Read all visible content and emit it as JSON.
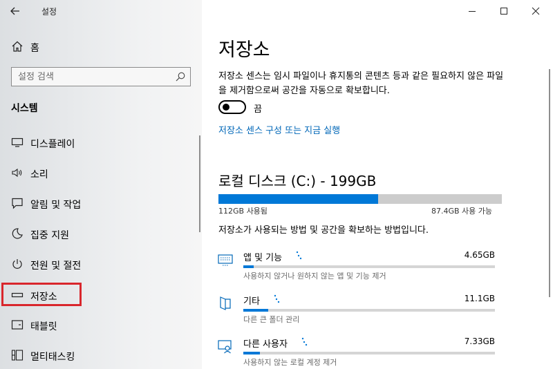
{
  "window": {
    "title": "설정"
  },
  "sidebar": {
    "home_label": "홈",
    "search_placeholder": "설정 검색",
    "section_title": "시스템",
    "items": [
      {
        "label": "디스플레이",
        "icon": "monitor-icon"
      },
      {
        "label": "소리",
        "icon": "speaker-icon"
      },
      {
        "label": "알림 및 작업",
        "icon": "notification-icon"
      },
      {
        "label": "집중 지원",
        "icon": "moon-icon"
      },
      {
        "label": "전원 및 절전",
        "icon": "power-icon"
      },
      {
        "label": "저장소",
        "icon": "storage-icon",
        "selected": true
      },
      {
        "label": "태블릿",
        "icon": "tablet-icon"
      },
      {
        "label": "멀티태스킹",
        "icon": "multitask-icon"
      }
    ]
  },
  "main": {
    "title": "저장소",
    "description": "저장소 센스는 임시 파일이나 휴지통의 콘텐츠 등과 같은 필요하지 않은 파일을 제거함으로써 공간을 자동으로 확보합니다.",
    "toggle": {
      "state": "off",
      "label": "끔"
    },
    "link": "저장소 센스 구성 또는 지금 실행",
    "disk": {
      "title": "로컬 디스크 (C:) - 199GB",
      "used_label": "112GB 사용됨",
      "free_label": "87.4GB 사용 가능",
      "used_fraction": 0.5628
    },
    "info": "저장소가 사용되는 방법 및 공간을 확보하는 방법입니다.",
    "categories": [
      {
        "name": "앱 및 기능",
        "size": "4.65GB",
        "desc": "사용하지 않거나 원하지 않는 앱 및 기능 제거",
        "fraction": 0.04,
        "icon": "apps-icon"
      },
      {
        "name": "기타",
        "size": "11.1GB",
        "desc": "다른 큰 폴더 관리",
        "fraction": 0.099,
        "icon": "folder-icon"
      },
      {
        "name": "다른 사용자",
        "size": "7.33GB",
        "desc": "사용하지 않는 로컬 계정 제거",
        "fraction": 0.065,
        "icon": "user-icon"
      }
    ]
  },
  "colors": {
    "accent": "#0078d7",
    "link": "#0067b8",
    "selection": "#d9262c"
  }
}
